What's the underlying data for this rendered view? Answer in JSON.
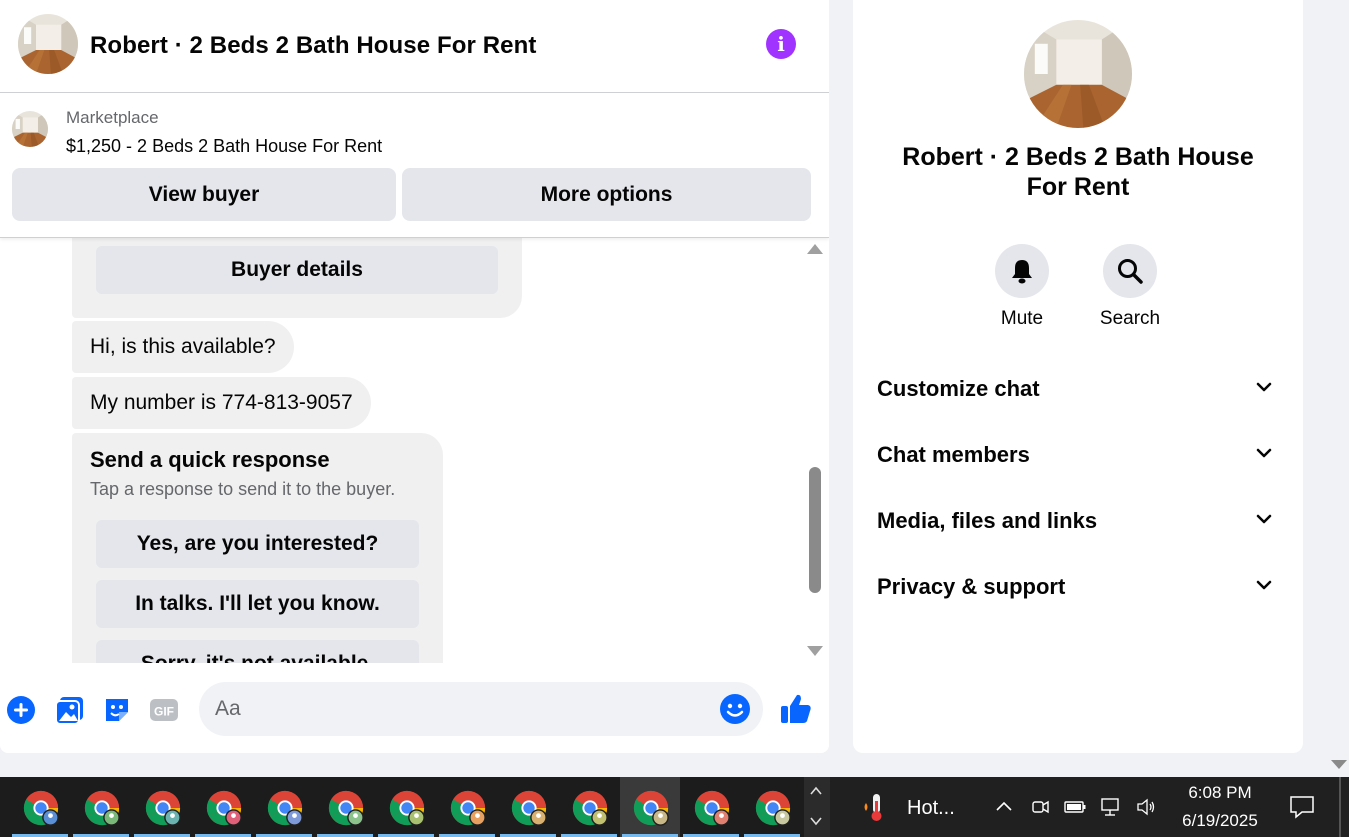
{
  "colors": {
    "accent": "#0866ff",
    "info": "#a033ff",
    "bubble": "#f0f0f0",
    "button": "#e4e6eb"
  },
  "chat": {
    "header": {
      "title": "Robert · 2 Beds 2 Bath House For Rent",
      "info_icon": "info-icon",
      "info_glyph": "i"
    },
    "listing": {
      "source": "Marketplace",
      "price_title": "$1,250 - 2 Beds 2 Bath House For Rent",
      "view_buyer_label": "View buyer",
      "more_options_label": "More options"
    },
    "messages": {
      "buyer_details_label": "Buyer details",
      "msg1": "Hi, is this available?",
      "msg2": "My number is 774-813-9057",
      "quick_response": {
        "title": "Send a quick response",
        "subtitle": "Tap a response to send it to the buyer.",
        "options": [
          "Yes, are you interested?",
          "In talks. I'll let you know.",
          "Sorry, it's not available."
        ]
      }
    },
    "composer": {
      "placeholder": "Aa",
      "icons": [
        "plus-icon",
        "image-icon",
        "sticker-icon",
        "gif-icon",
        "emoji-icon",
        "like-icon"
      ]
    }
  },
  "info_panel": {
    "title": "Robert · 2 Beds 2 Bath House For Rent",
    "actions": [
      {
        "label": "Mute",
        "icon": "bell-icon"
      },
      {
        "label": "Search",
        "icon": "search-icon"
      }
    ],
    "sections": [
      "Customize chat",
      "Chat members",
      "Media, files and links",
      "Privacy & support"
    ]
  },
  "taskbar": {
    "app_icon": "chrome-icon",
    "weather_text": "Hot...",
    "time": "6:08 PM",
    "date": "6/19/2025",
    "tray_icons": [
      "chevron-up-icon",
      "meet-now-icon",
      "battery-icon",
      "network-icon",
      "volume-icon"
    ]
  }
}
